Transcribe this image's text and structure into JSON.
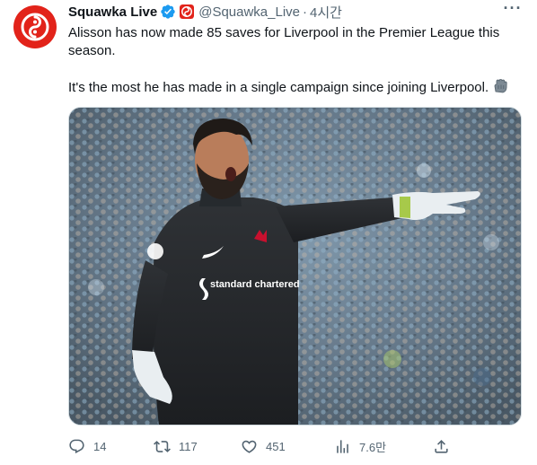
{
  "tweet": {
    "author_name": "Squawka Live",
    "handle": "@Squawka_Live",
    "separator": "·",
    "time": "4시간",
    "more_label": "···",
    "paragraph1": "Alisson has now made 85 saves for Liverpool in the Premier League this season.",
    "paragraph2": "It's the most he has made in a single campaign since joining Liverpool.",
    "emoji_name": "glove-emoji-icon",
    "media": {
      "description_icon": "photo-of-goalkeeper-pointing",
      "kit_sponsor": "standard chartered",
      "kit_brand": "nike"
    },
    "actions": {
      "replies": "14",
      "retweets": "117",
      "likes": "451",
      "views": "7.6만"
    }
  },
  "colors": {
    "brand_red": "#e2231a",
    "verified_blue": "#1d9bf0",
    "muted_text": "#536471",
    "primary_text": "#0f1419"
  }
}
